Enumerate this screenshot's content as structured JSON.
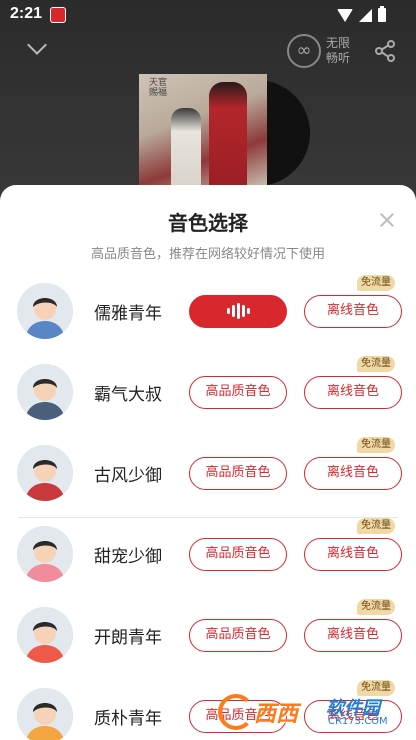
{
  "status_bar": {
    "time": "2:21"
  },
  "player": {
    "unlimited_label": "无限畅听",
    "album_title": "天官赐福"
  },
  "sheet": {
    "title": "音色选择",
    "subtitle": "高品质音色，推荐在网络较好情况下使用",
    "badge_label": "免流量",
    "hq_label": "高品质音色",
    "offline_label": "离线音色",
    "voices": [
      {
        "name": "儒雅青年",
        "hq_active": true,
        "avatar_color": "#5b86c6"
      },
      {
        "name": "霸气大叔",
        "hq_active": false,
        "avatar_color": "#4a5f7a"
      },
      {
        "name": "古风少御",
        "hq_active": false,
        "avatar_color": "#c9383c"
      },
      {
        "name": "甜宠少御",
        "hq_active": false,
        "avatar_color": "#f08c9c"
      },
      {
        "name": "开朗青年",
        "hq_active": false,
        "avatar_color": "#ef5a48"
      },
      {
        "name": "质朴青年",
        "hq_active": false,
        "avatar_color": "#f2a541"
      }
    ]
  },
  "watermark": {
    "text1": "西西",
    "text2": "软件园",
    "url": "CR173.COM"
  },
  "colors": {
    "accent": "#d9272e",
    "badge_bg": "#f1d9a6"
  }
}
